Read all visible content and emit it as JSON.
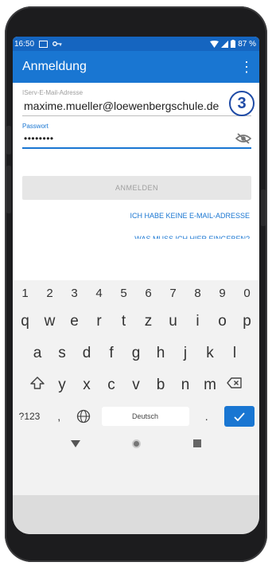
{
  "status_bar": {
    "time": "16:50",
    "battery": "87 %"
  },
  "app_bar": {
    "title": "Anmeldung",
    "menu_icon": "more-vert-icon"
  },
  "form": {
    "email": {
      "label": "IServ-E-Mail-Adresse",
      "value": "maxime.mueller@loewenbergschule.de"
    },
    "step_badge": "3",
    "password": {
      "label": "Passwort",
      "value": "••••••••",
      "icon": "eye-off-icon"
    },
    "login_button": "ANMELDEN",
    "link_no_email": "ICH HABE KEINE E-MAIL-ADRESSE",
    "link_what_enter": "WAS MUSS ICH HIER EINGEBEN?"
  },
  "keyboard": {
    "numbers": [
      "1",
      "2",
      "3",
      "4",
      "5",
      "6",
      "7",
      "8",
      "9",
      "0"
    ],
    "row1": [
      "q",
      "w",
      "e",
      "r",
      "t",
      "z",
      "u",
      "i",
      "o",
      "p"
    ],
    "row2": [
      "a",
      "s",
      "d",
      "f",
      "g",
      "h",
      "j",
      "k",
      "l"
    ],
    "row3": [
      "y",
      "x",
      "c",
      "v",
      "b",
      "n",
      "m"
    ],
    "symbols_key": "?123",
    "comma_key": ",",
    "space_key": "Deutsch",
    "period_key": ".",
    "accent_color": "#1976d2"
  }
}
